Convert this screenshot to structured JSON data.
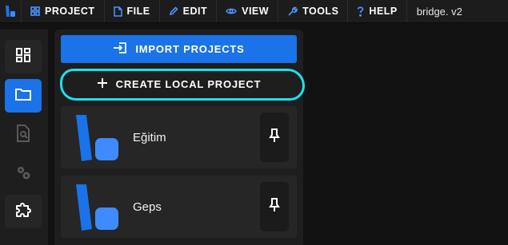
{
  "menubar": {
    "logo_icon": "bridge-logo-icon",
    "items": [
      {
        "label": "PROJECT",
        "icon": "grid-icon"
      },
      {
        "label": "FILE",
        "icon": "file-icon"
      },
      {
        "label": "EDIT",
        "icon": "pencil-icon"
      },
      {
        "label": "VIEW",
        "icon": "eye-icon"
      },
      {
        "label": "TOOLS",
        "icon": "wrench-icon"
      },
      {
        "label": "HELP",
        "icon": "question-icon"
      }
    ],
    "app_title": "bridge. v2"
  },
  "sidebar": {
    "items": [
      {
        "icon": "dashboard-icon",
        "active": false
      },
      {
        "icon": "folder-icon",
        "active": true
      },
      {
        "icon": "file-search-icon",
        "active": false
      },
      {
        "icon": "cogs-icon",
        "active": false
      },
      {
        "icon": "puzzle-icon",
        "active": false
      }
    ]
  },
  "panel": {
    "import_label": "IMPORT PROJECTS",
    "create_label": "CREATE LOCAL PROJECT",
    "projects": [
      {
        "name": "Eğitim"
      },
      {
        "name": "Geps"
      }
    ]
  },
  "colors": {
    "accent": "#1a73e8",
    "highlight": "#1ee0ee",
    "background": "#121212",
    "panel": "#1e1e1e"
  }
}
